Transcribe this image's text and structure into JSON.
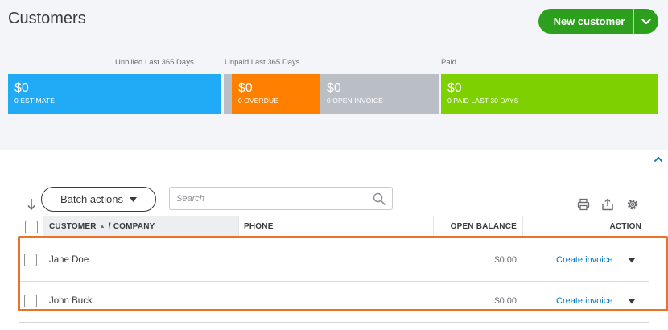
{
  "header": {
    "title": "Customers",
    "new_button_label": "New customer"
  },
  "sections": {
    "unbilled_label": "Unbilled Last 365 Days",
    "unpaid_label": "Unpaid Last 365 Days",
    "paid_label": "Paid"
  },
  "tiles": {
    "estimate": {
      "amount": "$0",
      "label": "0 ESTIMATE",
      "color": "#21abf6"
    },
    "overdue": {
      "amount": "$0",
      "label": "0 OVERDUE",
      "color": "#ff8000"
    },
    "open_invoice": {
      "amount": "$0",
      "label": "0 OPEN INVOICE",
      "color": "#babec5"
    },
    "paid": {
      "amount": "$0",
      "label": "0 PAID LAST 30 DAYS",
      "color": "#7fd000"
    }
  },
  "toolbar": {
    "batch_label": "Batch actions",
    "search_placeholder": "Search"
  },
  "table": {
    "headers": {
      "customer": "CUSTOMER",
      "sort_indicator": "▲",
      "company": "/ COMPANY",
      "phone": "PHONE",
      "balance": "OPEN BALANCE",
      "action": "ACTION"
    },
    "rows": [
      {
        "name": "Jane Doe",
        "balance": "$0.00",
        "action": "Create invoice"
      },
      {
        "name": "John Buck",
        "balance": "$0.00",
        "action": "Create invoice"
      }
    ]
  },
  "colors": {
    "accent_green": "#2ca01c",
    "link_blue": "#0077c5",
    "highlight_orange": "#ec7129"
  }
}
